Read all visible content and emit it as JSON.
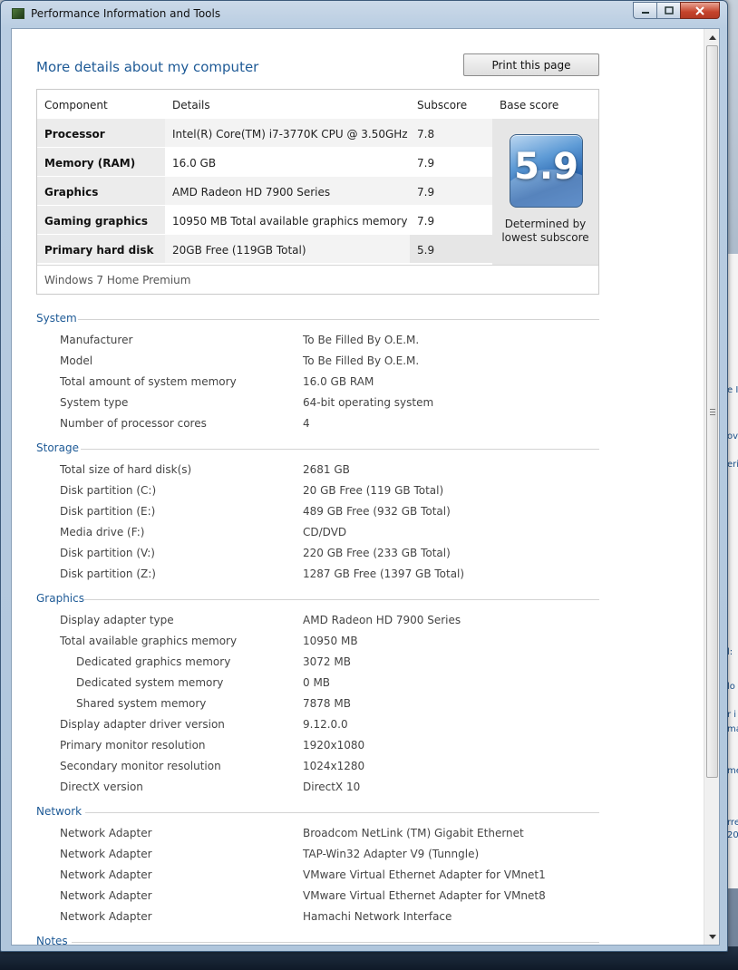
{
  "window": {
    "title": "Performance Information and Tools"
  },
  "header": {
    "title": "More details about my computer",
    "print_label": "Print this page"
  },
  "score_table": {
    "columns": [
      "Component",
      "Details",
      "Subscore",
      "Base score"
    ],
    "rows": [
      {
        "component": "Processor",
        "details": "Intel(R) Core(TM) i7-3770K CPU @ 3.50GHz",
        "subscore": "7.8"
      },
      {
        "component": "Memory (RAM)",
        "details": "16.0 GB",
        "subscore": "7.9"
      },
      {
        "component": "Graphics",
        "details": "AMD Radeon HD 7900 Series",
        "subscore": "7.9"
      },
      {
        "component": "Gaming graphics",
        "details": "10950 MB Total available graphics memory",
        "subscore": "7.9"
      },
      {
        "component": "Primary hard disk",
        "details": "20GB Free (119GB Total)",
        "subscore": "5.9"
      }
    ],
    "base_score": "5.9",
    "base_caption_1": "Determined by",
    "base_caption_2": "lowest subscore",
    "edition": "Windows 7 Home Premium"
  },
  "system": {
    "heading": "System",
    "items": [
      {
        "label": "Manufacturer",
        "value": "To Be Filled By O.E.M."
      },
      {
        "label": "Model",
        "value": "To Be Filled By O.E.M."
      },
      {
        "label": "Total amount of system memory",
        "value": "16.0 GB RAM"
      },
      {
        "label": "System type",
        "value": "64-bit operating system"
      },
      {
        "label": "Number of processor cores",
        "value": "4"
      }
    ]
  },
  "storage": {
    "heading": "Storage",
    "items": [
      {
        "label": "Total size of hard disk(s)",
        "value": "2681 GB"
      },
      {
        "label": "Disk partition (C:)",
        "value": "20 GB Free (119 GB Total)"
      },
      {
        "label": "Disk partition (E:)",
        "value": "489 GB Free (932 GB Total)"
      },
      {
        "label": "Media drive (F:)",
        "value": "CD/DVD"
      },
      {
        "label": "Disk partition (V:)",
        "value": "220 GB Free (233 GB Total)"
      },
      {
        "label": "Disk partition (Z:)",
        "value": "1287 GB Free (1397 GB Total)"
      }
    ]
  },
  "graphics": {
    "heading": "Graphics",
    "items": [
      {
        "label": "Display adapter type",
        "value": "AMD Radeon HD 7900 Series"
      },
      {
        "label": "Total available graphics memory",
        "value": "10950 MB"
      },
      {
        "label": "Dedicated graphics memory",
        "value": "3072 MB"
      },
      {
        "label": "Dedicated system memory",
        "value": "0 MB"
      },
      {
        "label": "Shared system memory",
        "value": "7878 MB"
      },
      {
        "label": "Display adapter driver version",
        "value": "9.12.0.0"
      },
      {
        "label": "Primary monitor resolution",
        "value": "1920x1080"
      },
      {
        "label": "Secondary monitor resolution",
        "value": "1024x1280"
      },
      {
        "label": "DirectX version",
        "value": "DirectX 10"
      }
    ]
  },
  "network": {
    "heading": "Network",
    "items": [
      {
        "label": "Network Adapter",
        "value": "Broadcom NetLink (TM) Gigabit Ethernet"
      },
      {
        "label": "Network Adapter",
        "value": "TAP-Win32 Adapter V9 (Tunngle)"
      },
      {
        "label": "Network Adapter",
        "value": "VMware Virtual Ethernet Adapter for VMnet1"
      },
      {
        "label": "Network Adapter",
        "value": "VMware Virtual Ethernet Adapter for VMnet8"
      },
      {
        "label": "Network Adapter",
        "value": "Hamachi Network Interface"
      }
    ]
  },
  "notes": {
    "heading": "Notes"
  },
  "background_window": {
    "fragments": [
      "e In",
      "ov",
      "eri",
      "l:",
      "lo",
      "r i",
      "ma",
      "me",
      "rre",
      "20"
    ]
  },
  "colors": {
    "accent": "#1e5a96",
    "table_shade": "#ececec",
    "close_button": "#c5432b"
  }
}
